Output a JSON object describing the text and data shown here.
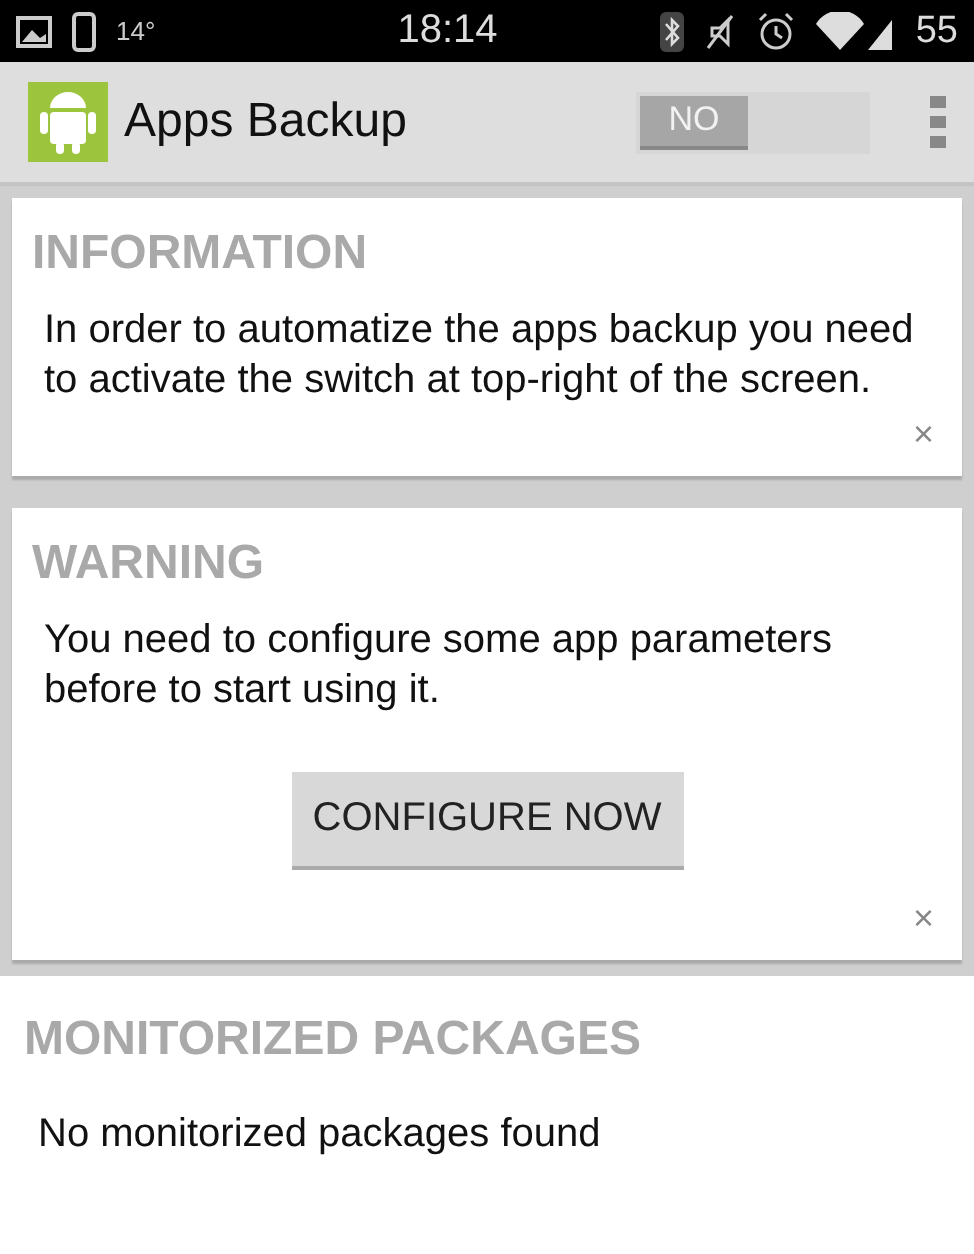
{
  "status_bar": {
    "temperature": "14°",
    "time": "18:14",
    "battery": "55"
  },
  "action_bar": {
    "title": "Apps Backup",
    "switch": {
      "label": "NO",
      "on": false
    }
  },
  "cards": [
    {
      "title": "INFORMATION",
      "text": "In order to automatize the apps backup you need to activate the switch at top-right of the screen.",
      "dismiss": "×"
    },
    {
      "title": "WARNING",
      "text": "You need to configure some app parameters before to start using it.",
      "button": "CONFIGURE NOW",
      "dismiss": "×"
    }
  ],
  "packages": {
    "title": "MONITORIZED PACKAGES",
    "empty_text": "No monitorized packages found"
  }
}
